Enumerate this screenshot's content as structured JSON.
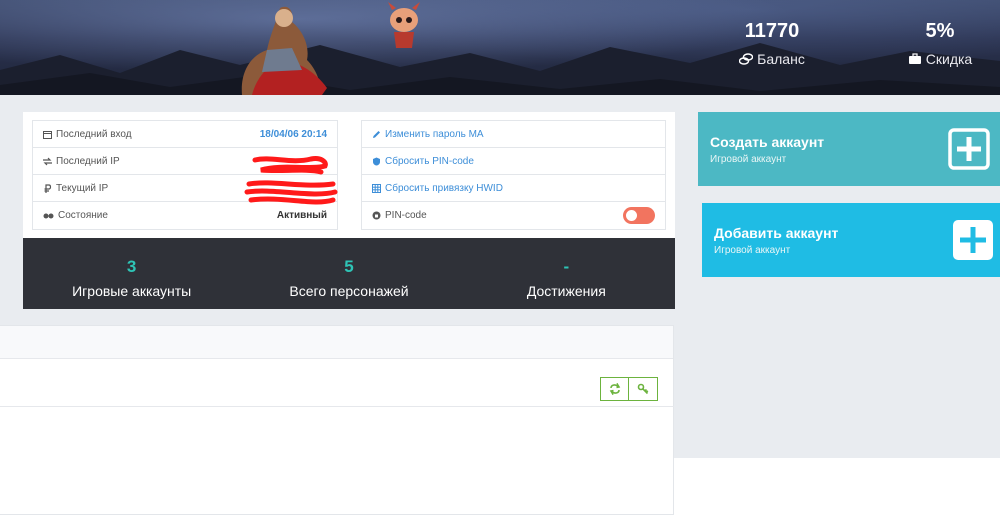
{
  "header": {
    "balance": {
      "value": "11770",
      "label": "Баланс",
      "icon": "coins-icon"
    },
    "discount": {
      "value": "5%",
      "label": "Скидка",
      "icon": "briefcase-icon"
    }
  },
  "info_left": {
    "rows": [
      {
        "label": "Последний вход",
        "value": "18/04/06 20:14",
        "icon": "calendar-icon"
      },
      {
        "label": "Последний IP",
        "value": "",
        "icon": "exchange-icon"
      },
      {
        "label": "Текущий IP",
        "value": "",
        "icon": "ruble-icon"
      },
      {
        "label": "Состояние",
        "value": "Активный",
        "icon": "glasses-icon"
      }
    ]
  },
  "info_right": {
    "rows": [
      {
        "label": "Изменить пароль МА",
        "icon": "pencil-icon"
      },
      {
        "label": "Сбросить PIN-code",
        "icon": "shield-icon"
      },
      {
        "label": "Сбросить привязку HWID",
        "icon": "grid-icon"
      },
      {
        "label": "PIN-code",
        "icon": "lock-icon"
      }
    ],
    "pin_toggle_on": false
  },
  "stats": [
    {
      "value": "3",
      "label": "Игровые аккаунты"
    },
    {
      "value": "5",
      "label": "Всего персонажей"
    },
    {
      "value": "-",
      "label": "Достижения"
    }
  ],
  "actions": {
    "create": {
      "title": "Создать аккаунт",
      "subtitle": "Игровой аккаунт",
      "color": "#4cb8c4"
    },
    "add": {
      "title": "Добавить аккаунт",
      "subtitle": "Игровой аккаунт",
      "color": "#1fbce4"
    }
  },
  "panel_buttons": [
    {
      "icon": "refresh-icon"
    },
    {
      "icon": "key-icon"
    }
  ],
  "colors": {
    "accent_teal": "#2ec4b6",
    "link_blue": "#3d8ed8",
    "dark_bar": "#2f3138",
    "toggle_off": "#f2745f",
    "button_green": "#6cb33e"
  }
}
